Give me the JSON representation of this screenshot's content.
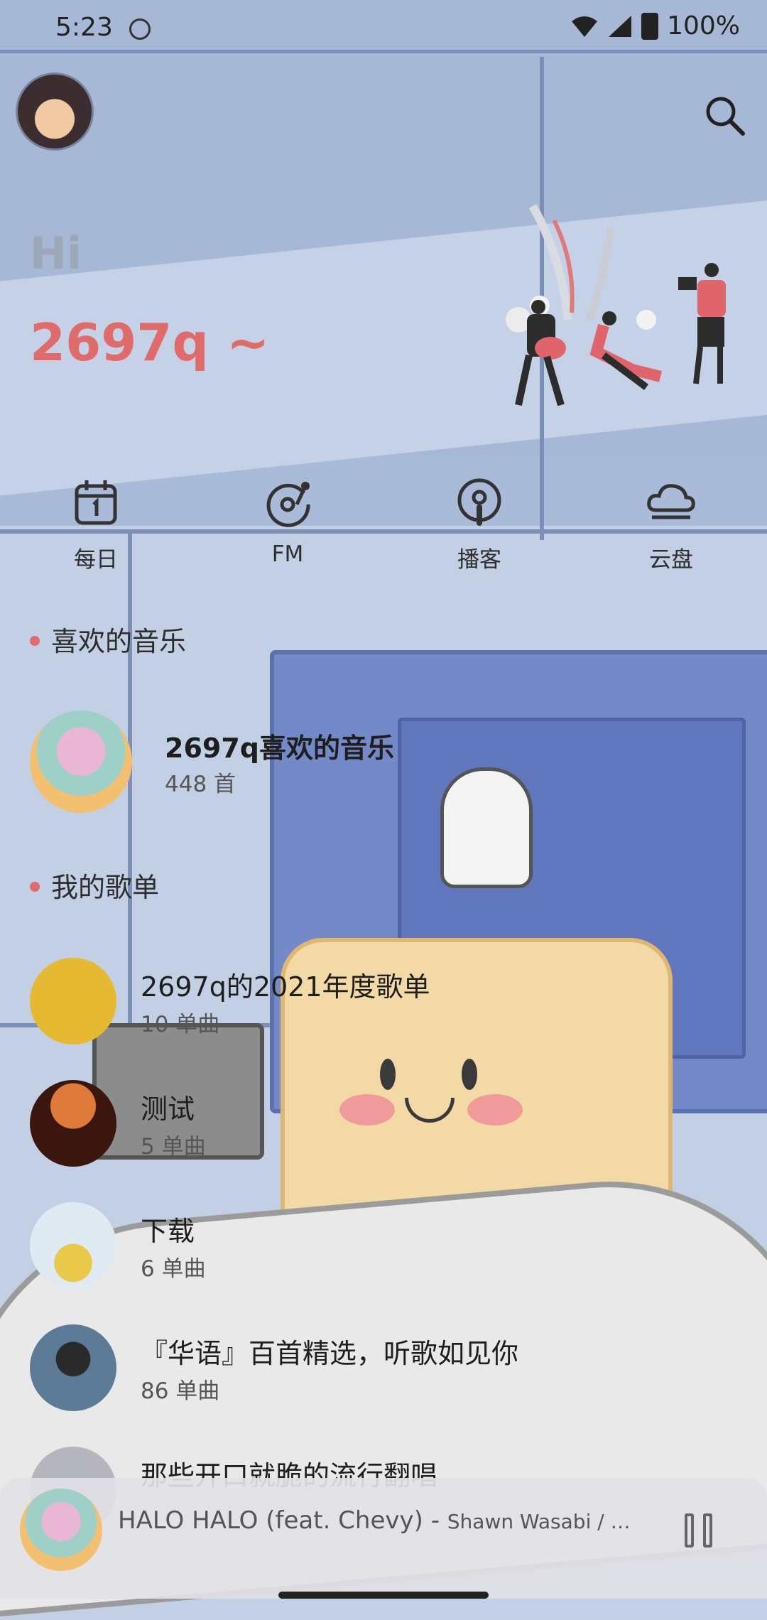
{
  "status_bar": {
    "time": "5:23",
    "battery": "100%"
  },
  "header": {
    "greeting": "Hi",
    "username": "2697q ~"
  },
  "quick_nav": [
    {
      "label": "每日",
      "icon": "calendar-icon"
    },
    {
      "label": "FM",
      "icon": "radio-disc-icon"
    },
    {
      "label": "播客",
      "icon": "podcast-icon"
    },
    {
      "label": "云盘",
      "icon": "cloud-icon"
    }
  ],
  "liked_section": {
    "title": "喜欢的音乐",
    "playlist_name": "2697q喜欢的音乐",
    "count": "448 首"
  },
  "my_playlists": {
    "title": "我的歌单",
    "items": [
      {
        "name": "2697q的2021年度歌单",
        "count": "10 单曲",
        "cover_color": "#e6b933"
      },
      {
        "name": "测试",
        "count": "5 单曲",
        "cover_color": "#5b2a1c"
      },
      {
        "name": "下载",
        "count": "6 单曲",
        "cover_color": "#cfe0ef"
      },
      {
        "name": "『华语』百首精选，听歌如见你",
        "count": "86 单曲",
        "cover_color": "#3d5670"
      },
      {
        "name": "那些开口就脆的流行翻唱",
        "count": "",
        "cover_color": "#b6b6bf"
      }
    ]
  },
  "player": {
    "song": "HALO HALO (feat. Chevy) - ",
    "artist": "Shawn Wasabi / …"
  },
  "colors": {
    "accent": "#e06b6b",
    "background": "#a9bbd8"
  }
}
